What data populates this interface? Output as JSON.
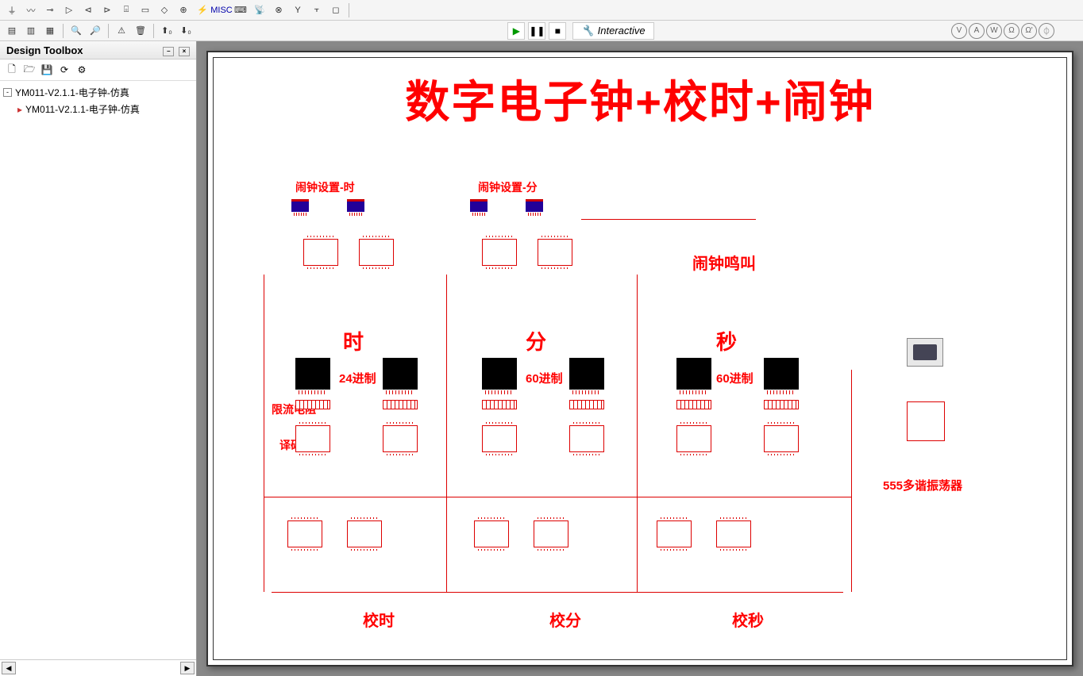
{
  "toolbar2": {
    "interactive_label": "Interactive"
  },
  "circles": [
    "V",
    "A",
    "W",
    "Ω",
    "Ω",
    "dB"
  ],
  "sidebar": {
    "title": "Design Toolbox",
    "root": "YM011-V2.1.1-电子钟-仿真",
    "child": "YM011-V2.1.1-电子钟-仿真"
  },
  "schematic": {
    "title": "数字电子钟+校时+闹钟",
    "alarm_set_hour": "闹钟设置-时",
    "alarm_set_minute": "闹钟设置-分",
    "alarm_ring": "闹钟鸣叫",
    "hour": "时",
    "minute": "分",
    "second": "秒",
    "base24": "24进制",
    "base60a": "60进制",
    "base60b": "60进制",
    "resistor_label": "限流电阻",
    "decoder_label": "译码器",
    "osc555": "555多谐振荡器",
    "adj_hour": "校时",
    "adj_minute": "校分",
    "adj_second": "校秒"
  }
}
